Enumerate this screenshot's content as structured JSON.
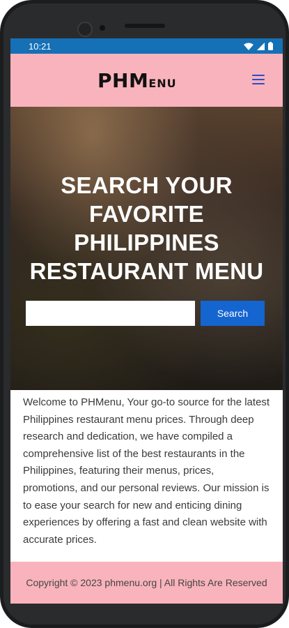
{
  "status_bar": {
    "time": "10:21"
  },
  "header": {
    "logo_main": "PHM",
    "logo_small": "ENU"
  },
  "hero": {
    "title_lines": [
      "SEARCH YOUR",
      "FAVORITE",
      "PHILIPPINES",
      "RESTAURANT MENU"
    ],
    "search_placeholder": "",
    "search_button_label": "Search"
  },
  "intro": {
    "text": "Welcome to PHMenu, Your go-to source for the latest Philippines restaurant menu prices. Through deep research and dedication, we have compiled a comprehensive list of the best restaurants in the Philippines, featuring their menus, prices, promotions, and our personal reviews. Our mission is to ease your search for new and enticing dining experiences by offering a fast and clean website with accurate prices."
  },
  "footer": {
    "text": "Copyright © 2023 phmenu.org | All Rights Are Reserved"
  },
  "icons": {
    "wifi": "wifi-icon",
    "signal": "signal-icon",
    "battery": "battery-icon",
    "menu": "hamburger-menu-icon"
  },
  "colors": {
    "status_bar": "#1570b5",
    "header_bg": "#f9b3bc",
    "footer_bg": "#f9b3bc",
    "search_button": "#1565d0",
    "menu_icon": "#2d4cc7"
  }
}
